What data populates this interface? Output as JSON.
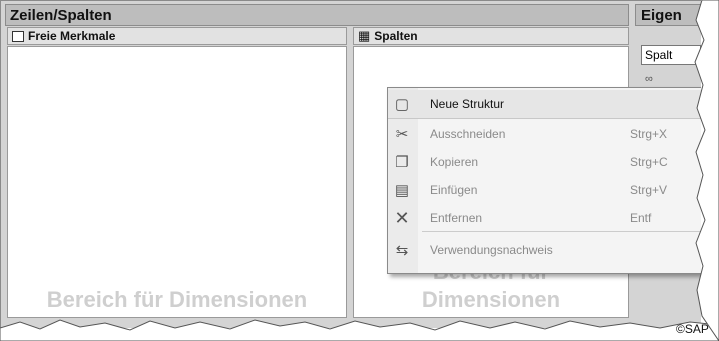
{
  "left_panel": {
    "title": "Zeilen/Spalten",
    "free_chars_label": "Freie Merkmale",
    "columns_label": "Spalten",
    "free_placeholder": "Bereich für Dimensionen",
    "columns_placeholder_1": "Bereich für",
    "columns_placeholder_2": "Dimensionen"
  },
  "right_panel": {
    "title": "Eigen",
    "tab": "Spalt"
  },
  "context_menu": {
    "items": [
      {
        "label": "Neue Struktur",
        "shortcut": "",
        "icon": "new-structure-icon",
        "enabled": true,
        "highlighted": true
      },
      {
        "label": "Ausschneiden",
        "shortcut": "Strg+X",
        "icon": "scissors-icon",
        "enabled": false
      },
      {
        "label": "Kopieren",
        "shortcut": "Strg+C",
        "icon": "copy-icon",
        "enabled": false
      },
      {
        "label": "Einfügen",
        "shortcut": "Strg+V",
        "icon": "paste-icon",
        "enabled": false
      },
      {
        "label": "Entfernen",
        "shortcut": "Entf",
        "icon": "remove-icon",
        "enabled": false
      },
      {
        "label": "Verwendungsnachweis",
        "shortcut": "",
        "icon": "where-used-icon",
        "enabled": false
      }
    ]
  },
  "credit": "©SAP"
}
